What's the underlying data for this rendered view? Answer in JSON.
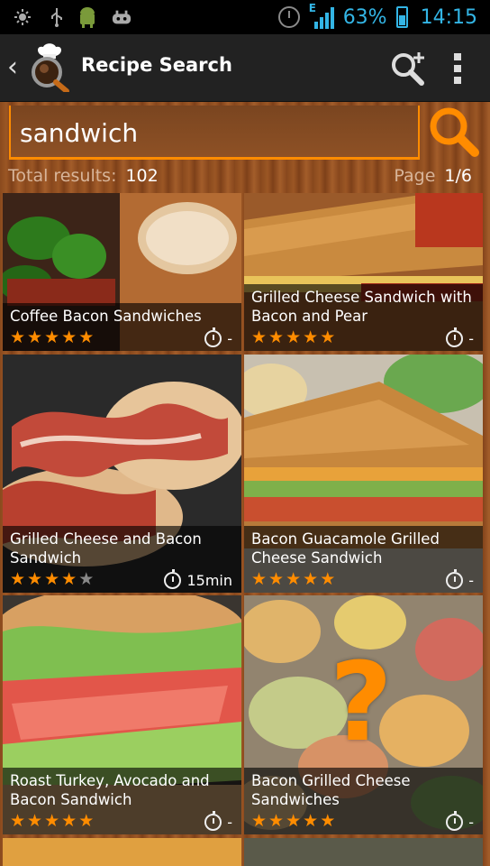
{
  "status_bar": {
    "battery": "63%",
    "time": "14:15",
    "network": "E"
  },
  "action_bar": {
    "title": "Recipe Search"
  },
  "search": {
    "query": "sandwich"
  },
  "results": {
    "total_label": "Total results:",
    "total": "102",
    "page_label": "Page",
    "page": "1/6"
  },
  "recipes": [
    {
      "name": "Coffee Bacon Sandwiches",
      "rating": 5,
      "time": "-"
    },
    {
      "name": "Grilled Cheese Sandwich with Bacon and Pear",
      "rating": 5,
      "time": "-"
    },
    {
      "name": "Grilled Cheese and Bacon Sandwich",
      "rating": 4,
      "time": "15min"
    },
    {
      "name": "Bacon Guacamole Grilled Cheese Sandwich",
      "rating": 5,
      "time": "-"
    },
    {
      "name": "Roast Turkey, Avocado and Bacon Sandwich",
      "rating": 5,
      "time": "-"
    },
    {
      "name": "Bacon Grilled Cheese Sandwiches",
      "rating": 5,
      "time": "-",
      "placeholder_glyph": "?"
    }
  ],
  "colors": {
    "accent": "#ff8c00",
    "status_blue": "#33b5e5",
    "action_bar": "#222222"
  }
}
